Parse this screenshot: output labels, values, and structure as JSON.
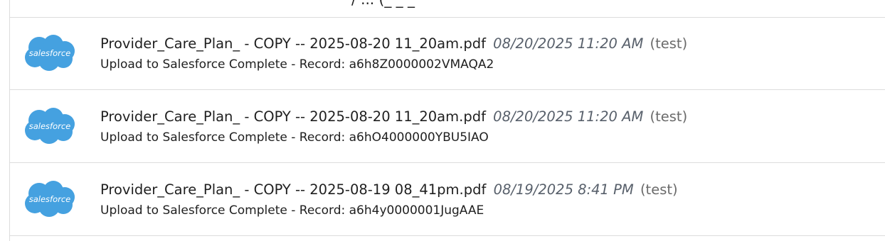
{
  "top_partial": {
    "text": "/ ... (_ _ _"
  },
  "items": [
    {
      "filename": "Provider_Care_Plan_ - COPY -- 2025-08-20 11_20am.pdf",
      "datetime": "08/20/2025 11:20 AM",
      "tag": "(test)",
      "status": "Upload to Salesforce Complete - Record: a6h8Z0000002VMAQA2",
      "logo_text": "salesforce"
    },
    {
      "filename": "Provider_Care_Plan_ - COPY -- 2025-08-20 11_20am.pdf",
      "datetime": "08/20/2025 11:20 AM",
      "tag": "(test)",
      "status": "Upload to Salesforce Complete - Record: a6hO4000000YBU5IAO",
      "logo_text": "salesforce"
    },
    {
      "filename": "Provider_Care_Plan_ - COPY -- 2025-08-19 08_41pm.pdf",
      "datetime": "08/19/2025 8:41 PM",
      "tag": "(test)",
      "status": "Upload to Salesforce Complete - Record: a6h4y0000001JugAAE",
      "logo_text": "salesforce"
    }
  ],
  "colors": {
    "salesforce_blue": "#45a1e0",
    "divider": "#dcdcdc"
  }
}
